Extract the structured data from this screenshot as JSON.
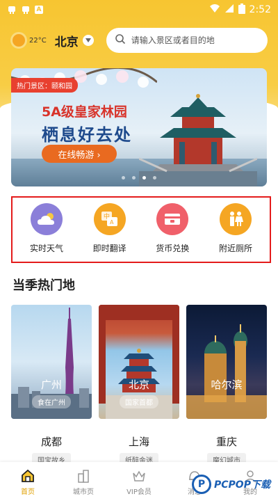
{
  "status_bar": {
    "time": "2:52"
  },
  "header": {
    "temperature": "22°C",
    "city": "北京",
    "search_placeholder": "请输入景区或者目的地"
  },
  "banner": {
    "tag": "热门景区：颐和园",
    "line1": "5A级皇家林园",
    "line2": "栖息好去处",
    "cta": "在线畅游 ›",
    "active_dot": 3,
    "dot_count": 4
  },
  "tools": [
    {
      "label": "实时天气",
      "icon": "weather-cloud-icon",
      "color": "#8b7fd9"
    },
    {
      "label": "即时翻译",
      "icon": "translate-icon",
      "color": "#f5a623"
    },
    {
      "label": "货币兑换",
      "icon": "currency-exchange-icon",
      "color": "#f0606a"
    },
    {
      "label": "附近厕所",
      "icon": "restroom-icon",
      "color": "#f5a623"
    }
  ],
  "section": {
    "title": "当季热门地"
  },
  "cards": [
    {
      "name": "广州",
      "tag": "食在广州"
    },
    {
      "name": "北京",
      "tag": "国家首都"
    },
    {
      "name": "哈尔滨",
      "tag": ""
    }
  ],
  "cities": [
    {
      "name": "成都",
      "tag": "国宝故乡"
    },
    {
      "name": "上海",
      "tag": "纸醉金迷"
    },
    {
      "name": "重庆",
      "tag": "魔幻城市"
    }
  ],
  "nav": [
    {
      "label": "首页",
      "icon": "home-icon",
      "active": true
    },
    {
      "label": "城市页",
      "icon": "city-icon",
      "active": false
    },
    {
      "label": "VIP会员",
      "icon": "vip-crown-icon",
      "active": false
    },
    {
      "label": "消息",
      "icon": "message-icon",
      "active": false
    },
    {
      "label": "我的",
      "icon": "profile-icon",
      "active": false
    }
  ],
  "watermark": {
    "letter": "P",
    "text": "PCPOP下载"
  },
  "colors": {
    "brand_yellow": "#f7c531",
    "accent_red": "#e41b1b",
    "cta_orange": "#e96a20"
  }
}
